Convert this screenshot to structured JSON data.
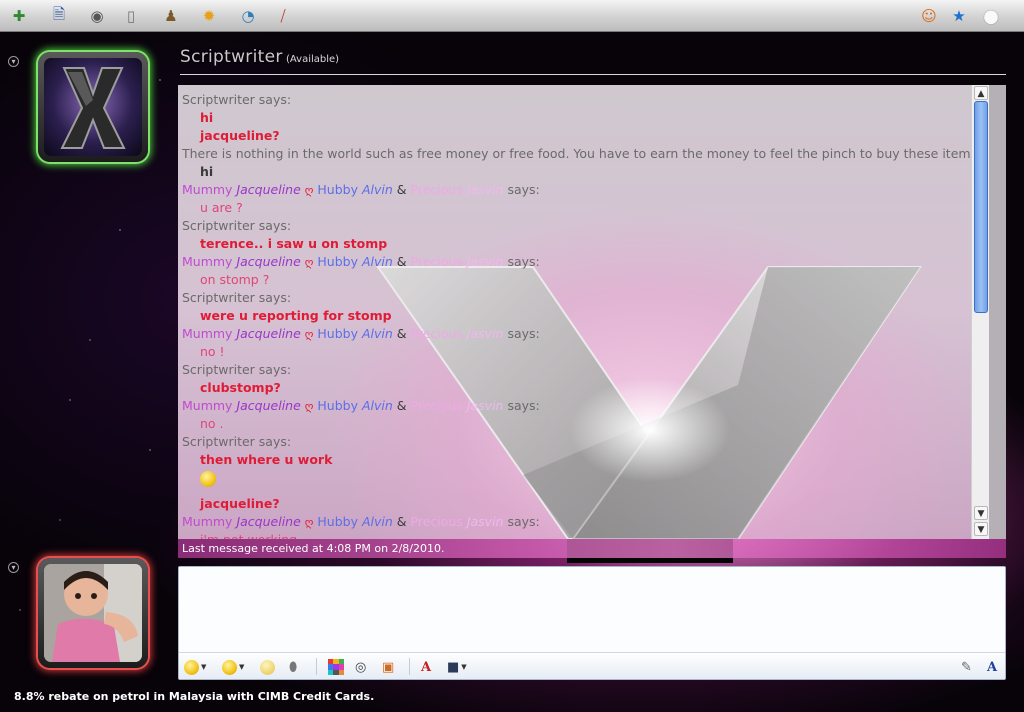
{
  "toolbar": {
    "left_icons": [
      "add-contact-icon",
      "send-file-icon",
      "webcam-icon",
      "phone-icon",
      "games-icon",
      "activities-icon",
      "sharing-folder-icon",
      "block-icon"
    ],
    "right_icons": [
      "wink-icon",
      "nudge-icon",
      "apple-menu-icon"
    ]
  },
  "header": {
    "contact_name": "Scriptwriter",
    "status": "(Available)"
  },
  "names": {
    "scriptwriter": "Scriptwriter says:",
    "long_name": "There is nothing in the world such as free money or free food. You have to earn the money to feel the pinch to buy these items says:",
    "mummy": "Mummy",
    "jacqueline": "Jacqueline",
    "heart": "ღ",
    "hubby": "Hubby",
    "alvin": "Alvin",
    "amp": "&",
    "precious": "Precious",
    "jasvin": "Jasvin",
    "says": "says:"
  },
  "messages": {
    "m1": "hi",
    "m2": "jacqueline?",
    "m3": "hi",
    "m4": "u are ?",
    "m5": "terence.. i saw u on stomp",
    "m6": "on stomp ?",
    "m7": "were u reporting for stomp",
    "m8": "no !",
    "m9": "clubstomp?",
    "m10": "no .",
    "m11": "then where u work",
    "m12": "jacqueline?",
    "m13": "i'm not working"
  },
  "status_bar": {
    "last_message": "Last message received at 4:08 PM on 2/8/2010."
  },
  "input": {
    "value": "",
    "toolbar_icons": [
      "emoticon-icon",
      "wink-emoticon-icon",
      "nudge-smile-icon",
      "voice-clip-icon",
      "backgrounds-icon",
      "wink-animation-icon",
      "send-gift-icon",
      "font-icon",
      "ink-icon"
    ],
    "mode_icons": [
      "handwriting-icon",
      "text-mode-icon"
    ]
  },
  "ad": {
    "text": "8.8% rebate on petrol in Malaysia with CIMB Credit Cards."
  }
}
